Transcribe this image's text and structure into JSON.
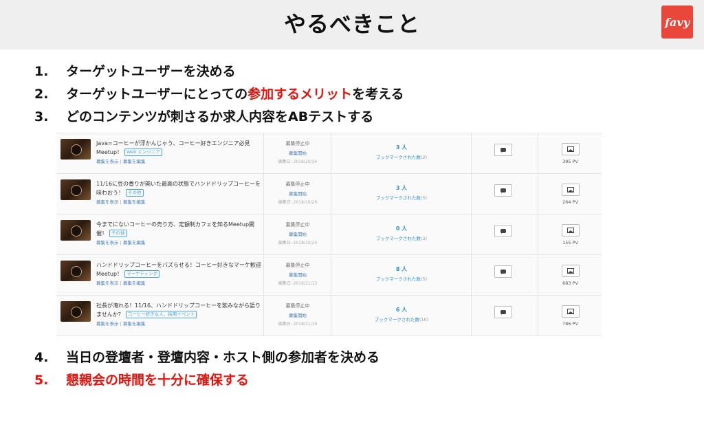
{
  "header": {
    "title": "やるべきこと",
    "logo": "favy"
  },
  "steps_top": [
    {
      "num": "1.",
      "before": "ターゲットユーザーを決める",
      "highlight": "",
      "after": ""
    },
    {
      "num": "2.",
      "before": "ターゲットユーザーにとっての",
      "highlight": "参加するメリット",
      "after": "を考える"
    },
    {
      "num": "3.",
      "before": "どのコンテンツが刺さるか求人内容をABテストする",
      "highlight": "",
      "after": ""
    }
  ],
  "events": [
    {
      "title": "Java=コーヒーが浮かんじゃう、コーヒー好きエンジニア必見Meetup！",
      "tag": "Web エンジニア",
      "view": "募集を表示",
      "edit": "募集を編集",
      "status": "募集停止中",
      "open": "募集開始",
      "edited": "編集日: 2018/10/24",
      "count": "3 人",
      "bookmark": "ブックマークされた数",
      "bookmark_count": "(2)",
      "pv": "395 PV"
    },
    {
      "title": "11/16に豆の香りが開いた最高の状態でハンドドリップコーヒーを味わおう！",
      "tag": "その他",
      "view": "募集を表示",
      "edit": "募集を編集",
      "status": "募集停止中",
      "open": "募集開始",
      "edited": "編集日: 2018/10/26",
      "count": "3 人",
      "bookmark": "ブックマークされた数",
      "bookmark_count": "(5)",
      "pv": "264 PV"
    },
    {
      "title": "今までにないコーヒーの売り方、定額制カフェを知るMeetup開催！",
      "tag": "その他",
      "view": "募集を表示",
      "edit": "募集を編集",
      "status": "募集停止中",
      "open": "募集開始",
      "edited": "編集日: 2018/10/24",
      "count": "0 人",
      "bookmark": "ブックマークされた数",
      "bookmark_count": "(3)",
      "pv": "155 PV"
    },
    {
      "title": "ハンドドリップコーヒーをバズらせる！コーヒー好きなマーケ歓迎Meetup！",
      "tag": "マーケティング",
      "view": "募集を表示",
      "edit": "募集を編集",
      "status": "募集停止中",
      "open": "募集開始",
      "edited": "編集日: 2018/11/13",
      "count": "8 人",
      "bookmark": "ブックマークされた数",
      "bookmark_count": "(5)",
      "pv": "683 PV"
    },
    {
      "title": "社長が淹れる！11/16、ハンドドリップコーヒーを飲みながら語りませんか？",
      "tag": "コーヒー好きな人、採用イベント",
      "view": "募集を表示",
      "edit": "募集を編集",
      "status": "募集停止中",
      "open": "募集開始",
      "edited": "編集日: 2018/11/19",
      "count": "6 人",
      "bookmark": "ブックマークされた数",
      "bookmark_count": "(10)",
      "pv": "786 PV"
    }
  ],
  "steps_bottom": [
    {
      "num": "4.",
      "text": "当日の登壇者・登壇内容・ホスト側の参加者を決める",
      "emphasis": false
    },
    {
      "num": "5.",
      "text": "懇親会の時間を十分に確保する",
      "emphasis": true
    }
  ]
}
